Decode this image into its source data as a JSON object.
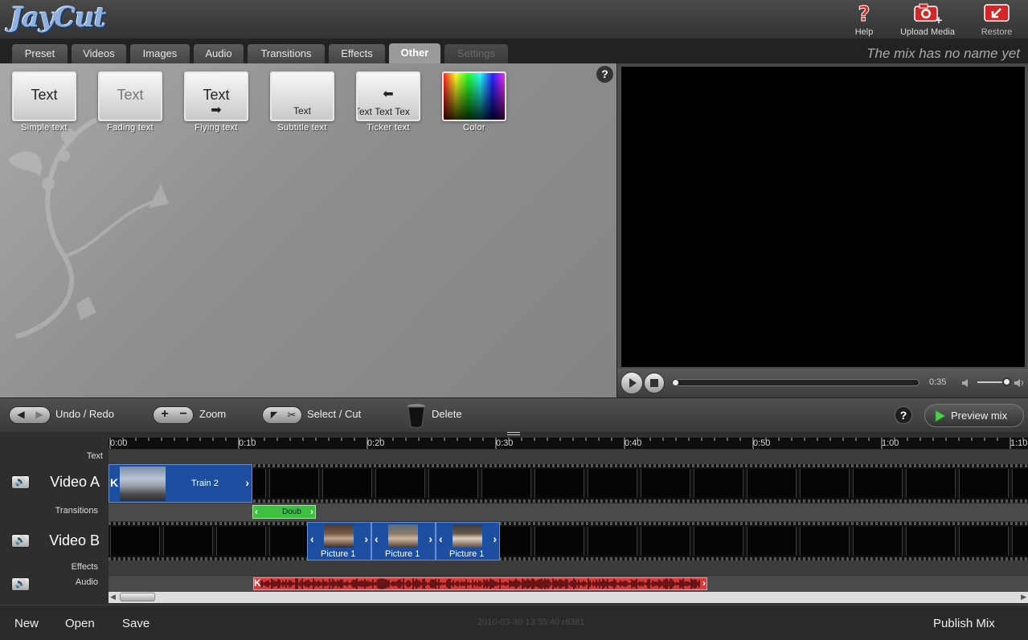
{
  "app": {
    "logo": "JayCut"
  },
  "topnav": [
    {
      "label": "Help",
      "icon": "help-icon"
    },
    {
      "label": "Upload Media",
      "icon": "camera-upload-icon"
    },
    {
      "label": "Restore",
      "icon": "restore-icon"
    }
  ],
  "tabs": [
    {
      "label": "Preset",
      "state": "normal"
    },
    {
      "label": "Videos",
      "state": "normal"
    },
    {
      "label": "Images",
      "state": "normal"
    },
    {
      "label": "Audio",
      "state": "normal"
    },
    {
      "label": "Transitions",
      "state": "normal"
    },
    {
      "label": "Effects",
      "state": "normal"
    },
    {
      "label": "Other",
      "state": "active"
    },
    {
      "label": "Settings",
      "state": "disabled"
    }
  ],
  "mix_name": "The mix has no name yet",
  "other_panel": {
    "help": "?",
    "items": [
      {
        "label": "Simple text",
        "sample": "Text"
      },
      {
        "label": "Fading text",
        "sample": "Text"
      },
      {
        "label": "Flying text",
        "sample": "Text"
      },
      {
        "label": "Subtitle text",
        "sample": "Text"
      },
      {
        "label": "Ticker text",
        "sample": "Text Text Tex"
      },
      {
        "label": "Color",
        "sample": ""
      }
    ]
  },
  "player": {
    "time": "0:35",
    "progress": 0.0,
    "volume": 0.9
  },
  "toolbar": {
    "undo_redo": "Undo / Redo",
    "zoom": "Zoom",
    "select_cut": "Select / Cut",
    "delete": "Delete",
    "help": "?",
    "preview_mix": "Preview mix"
  },
  "timeline": {
    "ruler": [
      "0:00",
      "0:10",
      "0:20",
      "0:30",
      "0:40",
      "0:50",
      "1:00",
      "1:10"
    ],
    "tracks": {
      "text": "Text",
      "video_a": "Video A",
      "transitions": "Transitions",
      "video_b": "Video B",
      "effects": "Effects",
      "audio": "Audio"
    },
    "clips": {
      "video_a": [
        {
          "label": "Train 2"
        }
      ],
      "transition": [
        {
          "label": "Doub"
        }
      ],
      "video_b": [
        {
          "label": "Picture 1"
        },
        {
          "label": "Picture 1"
        },
        {
          "label": "Picture 1"
        }
      ]
    }
  },
  "bottombar": {
    "new": "New",
    "open": "Open",
    "save": "Save",
    "timestamp": "2010-03-30 13:55:40 r8381",
    "publish": "Publish Mix"
  }
}
